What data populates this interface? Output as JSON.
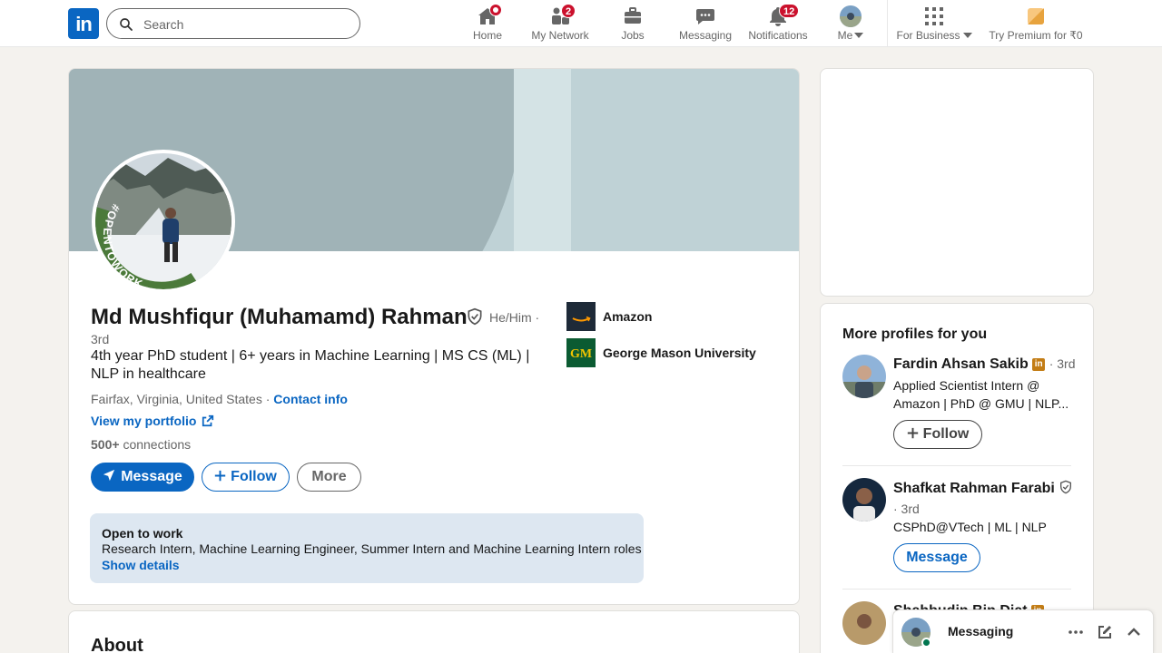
{
  "nav": {
    "logo_text": "in",
    "search_placeholder": "Search",
    "items": [
      {
        "label": "Home",
        "icon": "home-icon"
      },
      {
        "label": "My Network",
        "icon": "network-icon",
        "badge": "2"
      },
      {
        "label": "Jobs",
        "icon": "briefcase-icon"
      },
      {
        "label": "Messaging",
        "icon": "chat-icon"
      },
      {
        "label": "Notifications",
        "icon": "bell-icon",
        "badge": "12"
      },
      {
        "label": "Me",
        "icon": "avatar"
      },
      {
        "label": "For Business",
        "icon": "grid-icon"
      },
      {
        "label": "Try Premium for ₹0",
        "icon": "premium-icon"
      }
    ]
  },
  "profile": {
    "name": "Md Mushfiqur (Muhamamd) Rahman",
    "pronouns": "He/Him ·",
    "degree": "3rd",
    "headline": "4th year PhD student | 6+ years in Machine Learning | MS CS (ML) | NLP in healthcare",
    "location": "Fairfax, Virginia, United States",
    "location_sep": " · ",
    "contact_label": "Contact info",
    "portfolio_label": "View my portfolio",
    "connections_count": "500+",
    "connections_label": "connections",
    "badge_text": "#OPENTOWORK",
    "buttons": {
      "message": "Message",
      "follow": "Follow",
      "more": "More"
    },
    "companies": [
      {
        "name": "Amazon"
      },
      {
        "name": "George Mason University"
      }
    ],
    "open_to_work": {
      "title": "Open to work",
      "roles": "Research Intern, Machine Learning Engineer, Summer Intern and Machine Learning Intern roles",
      "show_details": "Show details"
    }
  },
  "about": {
    "title": "About"
  },
  "sidebar": {
    "more_profiles_title": "More profiles for you",
    "profiles": [
      {
        "name": "Fardin Ahsan Sakib",
        "degree": "· 3rd",
        "headline": "Applied Scientist Intern @ Amazon | PhD @ GMU | NLP...",
        "action": "Follow"
      },
      {
        "name": "Shafkat Rahman Farabi",
        "degree": "· 3rd",
        "headline": "CSPhD@VTech | ML | NLP",
        "action": "Message"
      },
      {
        "name": "Shahbudin Bin Diat",
        "degree": "",
        "headline": "",
        "action": ""
      }
    ]
  },
  "messaging": {
    "label": "Messaging"
  },
  "colors": {
    "brand": "#0a66c2",
    "badge": "#cb112d",
    "open_to_work_bg": "#dde7f1",
    "opentowork_ring": "#4b7a3a"
  }
}
